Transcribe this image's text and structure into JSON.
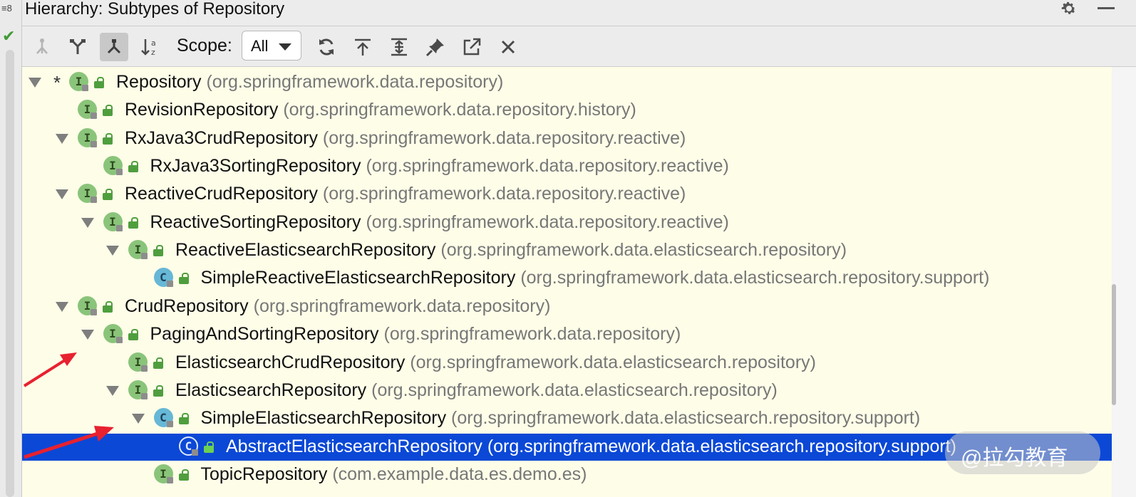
{
  "gutter": {
    "line_marker": "8"
  },
  "title": {
    "text": "Hierarchy:  Subtypes of Repository"
  },
  "toolbar": {
    "scope_label": "Scope:",
    "scope_value": "All",
    "buttons": [
      {
        "name": "type-hierarchy-icon"
      },
      {
        "name": "supertypes-hierarchy-icon"
      },
      {
        "name": "subtypes-hierarchy-icon",
        "active": true
      },
      {
        "name": "sort-alphabetically-icon"
      },
      {
        "name": "refresh-icon"
      },
      {
        "name": "base-on-this-class-icon"
      },
      {
        "name": "expand-all-icon"
      },
      {
        "name": "pin-icon"
      },
      {
        "name": "export-icon"
      },
      {
        "name": "close-icon"
      }
    ]
  },
  "tree": {
    "rows": [
      {
        "name": "Repository",
        "pkg": "(org.springframework.data.repository)",
        "kind": "I",
        "depth": 0,
        "expanded": true,
        "star": true
      },
      {
        "name": "RevisionRepository",
        "pkg": "(org.springframework.data.repository.history)",
        "kind": "I",
        "depth": 1,
        "expanded": false
      },
      {
        "name": "RxJava3CrudRepository",
        "pkg": "(org.springframework.data.repository.reactive)",
        "kind": "I",
        "depth": 1,
        "expanded": true
      },
      {
        "name": "RxJava3SortingRepository",
        "pkg": "(org.springframework.data.repository.reactive)",
        "kind": "I",
        "depth": 2,
        "expanded": false
      },
      {
        "name": "ReactiveCrudRepository",
        "pkg": "(org.springframework.data.repository.reactive)",
        "kind": "I",
        "depth": 1,
        "expanded": true
      },
      {
        "name": "ReactiveSortingRepository",
        "pkg": "(org.springframework.data.repository.reactive)",
        "kind": "I",
        "depth": 2,
        "expanded": true
      },
      {
        "name": "ReactiveElasticsearchRepository",
        "pkg": "(org.springframework.data.elasticsearch.repository)",
        "kind": "I",
        "depth": 3,
        "expanded": true
      },
      {
        "name": "SimpleReactiveElasticsearchRepository",
        "pkg": "(org.springframework.data.elasticsearch.repository.support)",
        "kind": "C",
        "depth": 4,
        "expanded": false
      },
      {
        "name": "CrudRepository",
        "pkg": "(org.springframework.data.repository)",
        "kind": "I",
        "depth": 1,
        "expanded": true
      },
      {
        "name": "PagingAndSortingRepository",
        "pkg": "(org.springframework.data.repository)",
        "kind": "I",
        "depth": 2,
        "expanded": true
      },
      {
        "name": "ElasticsearchCrudRepository",
        "pkg": "(org.springframework.data.elasticsearch.repository)",
        "kind": "I",
        "depth": 3,
        "expanded": false
      },
      {
        "name": "ElasticsearchRepository",
        "pkg": "(org.springframework.data.elasticsearch.repository)",
        "kind": "I",
        "depth": 3,
        "expanded": true
      },
      {
        "name": "SimpleElasticsearchRepository",
        "pkg": "(org.springframework.data.elasticsearch.repository.support)",
        "kind": "C",
        "depth": 4,
        "expanded": true
      },
      {
        "name": "AbstractElasticsearchRepository",
        "pkg": "(org.springframework.data.elasticsearch.repository.support)",
        "kind": "C",
        "depth": 5,
        "expanded": false,
        "selected": true
      },
      {
        "name": "TopicRepository",
        "pkg": "(com.example.data.es.demo.es)",
        "kind": "I",
        "depth": 4,
        "expanded": false
      }
    ]
  },
  "watermark": {
    "text": "@拉勾教育"
  }
}
